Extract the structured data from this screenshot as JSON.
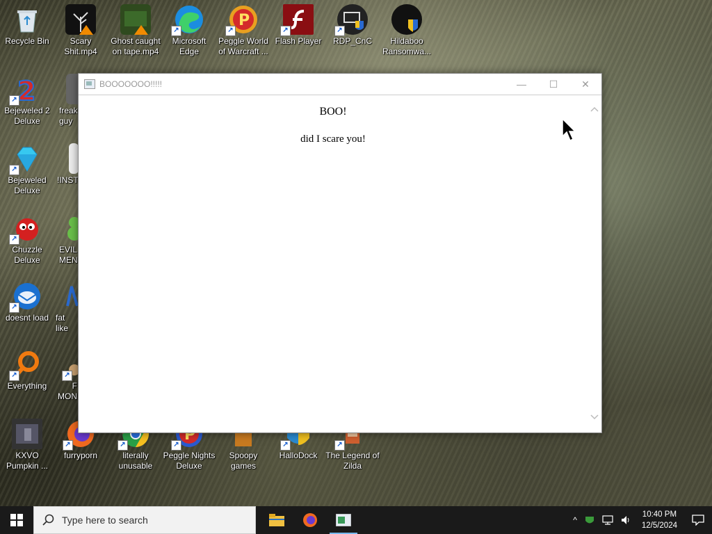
{
  "desktop": {
    "icons": [
      {
        "label": "Recycle Bin"
      },
      {
        "label": "Scary Shit.mp4"
      },
      {
        "label": "Ghost caught on tape.mp4"
      },
      {
        "label": "Microsoft Edge"
      },
      {
        "label": "Peggle World of Warcraft ..."
      },
      {
        "label": "Flash Player"
      },
      {
        "label": "RDP_CnC"
      },
      {
        "label": "Hildaboo Ransomwa..."
      },
      {
        "label": "Bejeweled 2 Deluxe"
      },
      {
        "label": "freak guy"
      },
      {
        "label": "Bejeweled Deluxe"
      },
      {
        "label": "!INSTA"
      },
      {
        "label": "Chuzzle Deluxe"
      },
      {
        "label": "EVIL MEN"
      },
      {
        "label": "doesnt load"
      },
      {
        "label": "fat like"
      },
      {
        "label": "Everything"
      },
      {
        "label": "F MON"
      },
      {
        "label": "KXVO Pumpkin ..."
      },
      {
        "label": "furryporn"
      },
      {
        "label": "literally unusable"
      },
      {
        "label": "Peggle Nights Deluxe"
      },
      {
        "label": "Spoopy games"
      },
      {
        "label": "HalloDock"
      },
      {
        "label": "The Legend of Zilda"
      }
    ]
  },
  "window": {
    "title": "BOOOOOOO!!!!!",
    "heading": "BOO!",
    "message": "did I scare you!",
    "minimize_glyph": "—",
    "maximize_glyph": "☐",
    "close_glyph": "✕"
  },
  "taskbar": {
    "search_placeholder": "Type here to search",
    "time": "10:40 PM",
    "date": "12/5/2024",
    "tray_chevron": "^"
  },
  "colors": {
    "taskbar_bg": "#1a1a1a",
    "accent": "#76b9ed"
  }
}
